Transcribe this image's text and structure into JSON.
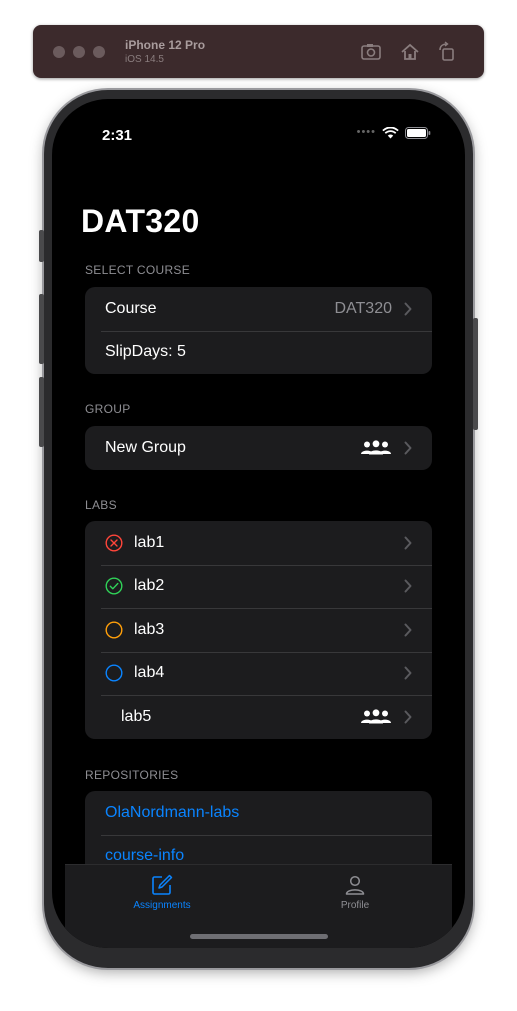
{
  "simulator": {
    "device": "iPhone 12 Pro",
    "os": "iOS 14.5",
    "icons": [
      "screenshot-icon",
      "home-icon",
      "rotate-icon"
    ]
  },
  "status_bar": {
    "time": "2:31"
  },
  "page": {
    "title": "DAT320"
  },
  "sections": {
    "select_course": {
      "header": "SELECT COURSE",
      "course_label": "Course",
      "course_value": "DAT320",
      "slipdays_label": "SlipDays: 5"
    },
    "group": {
      "header": "GROUP",
      "new_group_label": "New Group"
    },
    "labs": {
      "header": "LABS",
      "items": [
        {
          "label": "lab1",
          "status_icon": "x-circle-icon",
          "color": "#ff453a"
        },
        {
          "label": "lab2",
          "status_icon": "check-circle-icon",
          "color": "#30d158"
        },
        {
          "label": "lab3",
          "status_icon": "circle-icon",
          "color": "#ff9f0a"
        },
        {
          "label": "lab4",
          "status_icon": "circle-icon",
          "color": "#0a84ff"
        },
        {
          "label": "lab5",
          "status_icon": "group-icon",
          "color": "#ffffff"
        }
      ]
    },
    "repositories": {
      "header": "REPOSITORIES",
      "items": [
        "OlaNordmann-labs",
        "course-info"
      ]
    }
  },
  "tabbar": {
    "tabs": [
      {
        "label": "Assignments",
        "icon": "compose-icon",
        "selected": true
      },
      {
        "label": "Profile",
        "icon": "person-icon",
        "selected": false
      }
    ]
  },
  "colors": {
    "accent": "#0a84ff",
    "background": "#000000",
    "cell": "#1c1c1e",
    "secondary_text": "#8e8e93"
  }
}
